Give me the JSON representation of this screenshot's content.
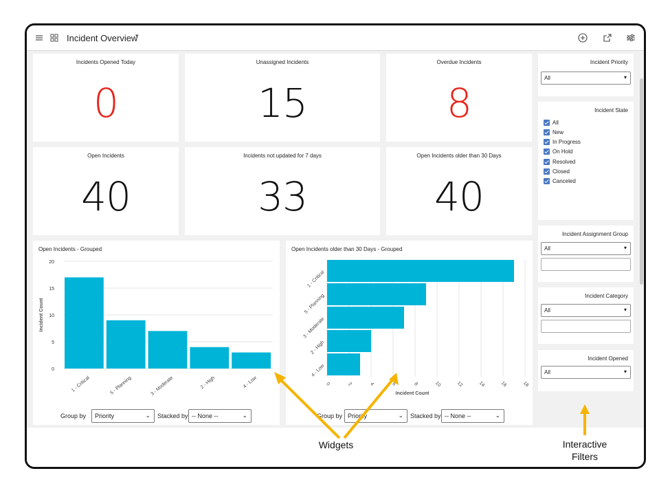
{
  "header": {
    "title": "Incident Overview",
    "menu_icon": "hamburger-menu-icon",
    "grid_icon": "dashboard-grid-icon",
    "title_caret_icon": "chevron-down-icon",
    "add_icon": "add-circle-icon",
    "share_icon": "share-export-icon",
    "settings_icon": "filter-settings-icon"
  },
  "kpis": [
    {
      "title": "Incidents Opened Today",
      "value": "0",
      "color": "#e8231b"
    },
    {
      "title": "Unassigned Incidents",
      "value": "15",
      "color": "#111111"
    },
    {
      "title": "Overdue Incidents",
      "value": "8",
      "color": "#e8231b"
    },
    {
      "title": "Open Incidents",
      "value": "40",
      "color": "#111111"
    },
    {
      "title": "Incidents not updated for 7 days",
      "value": "33",
      "color": "#111111"
    },
    {
      "title": "Open Incidents older than 30 Days",
      "value": "40",
      "color": "#111111"
    }
  ],
  "charts": {
    "left": {
      "title": "Open Incidents - Grouped",
      "group_by_label": "Group by",
      "group_by_value": "Priority",
      "stacked_by_label": "Stacked by",
      "stacked_by_value": "-- None --"
    },
    "right": {
      "title": "Open Incidents older than 30 Days - Grouped",
      "group_by_label": "Group by",
      "group_by_value": "Priority",
      "stacked_by_label": "Stacked by",
      "stacked_by_value": "-- None --"
    }
  },
  "chart_data": [
    {
      "type": "bar",
      "title": "Open Incidents - Grouped",
      "categories": [
        "1 - Critical",
        "5 - Planning",
        "3 - Moderate",
        "2 - High",
        "4 - Low"
      ],
      "values": [
        17,
        9,
        7,
        4,
        3
      ],
      "xlabel": "",
      "ylabel": "Incident Count",
      "ylim": [
        0,
        20
      ],
      "yticks": [
        0,
        5,
        10,
        15,
        20
      ],
      "color": "#00b4d8",
      "grid": true
    },
    {
      "type": "bar",
      "orientation": "horizontal",
      "title": "Open Incidents older than 30 Days - Grouped",
      "categories": [
        "1 - Critical",
        "5 - Planning",
        "3 - Moderate",
        "2 - High",
        "4 - Low"
      ],
      "values": [
        17,
        9,
        7,
        4,
        3
      ],
      "xlabel": "Incident Count",
      "ylabel": "",
      "xlim": [
        0,
        18
      ],
      "xticks": [
        0,
        2,
        4,
        6,
        8,
        10,
        12,
        14,
        16,
        18
      ],
      "color": "#00b4d8",
      "grid": true
    }
  ],
  "filters": {
    "priority": {
      "title": "Incident Priority",
      "value": "All"
    },
    "state": {
      "title": "Incident State",
      "options": [
        "All",
        "New",
        "In Progress",
        "On Hold",
        "Resolved",
        "Closed",
        "Canceled"
      ]
    },
    "assignment_group": {
      "title": "Incident Assignment Group",
      "value": "All"
    },
    "category": {
      "title": "Incident Category",
      "value": "All"
    },
    "opened": {
      "title": "Incident Opened",
      "value": "All"
    }
  },
  "annotations": {
    "widgets": "Widgets",
    "filters_line1": "Interactive",
    "filters_line2": "Filters",
    "arrow_color": "#f5b400"
  }
}
